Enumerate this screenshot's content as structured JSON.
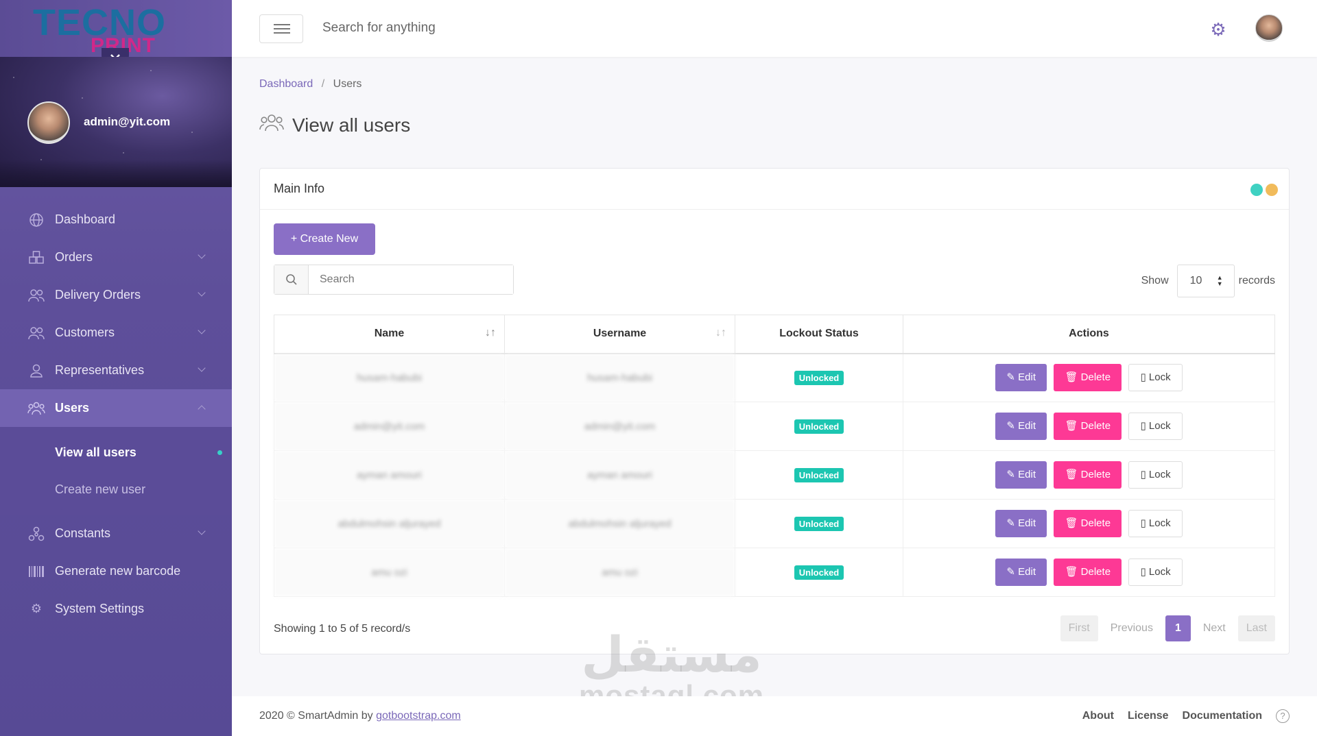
{
  "brand": {
    "logo_top": "TECNO",
    "logo_bottom": "PRINT"
  },
  "profile": {
    "email": "admin@yit.com"
  },
  "sidebar": {
    "items": [
      {
        "label": "Dashboard",
        "icon": "globe-icon"
      },
      {
        "label": "Orders",
        "icon": "boxes-icon"
      },
      {
        "label": "Delivery Orders",
        "icon": "users-icon"
      },
      {
        "label": "Customers",
        "icon": "users-icon"
      },
      {
        "label": "Representatives",
        "icon": "user-icon"
      },
      {
        "label": "Users",
        "icon": "users-icon"
      },
      {
        "label": "Constants",
        "icon": "nodes-icon"
      },
      {
        "label": "Generate new barcode",
        "icon": "barcode-icon"
      },
      {
        "label": "System Settings",
        "icon": "gear-icon"
      }
    ],
    "sub_items": [
      {
        "label": "View all users"
      },
      {
        "label": "Create new user"
      }
    ]
  },
  "header": {
    "search_placeholder": "Search for anything"
  },
  "breadcrumb": {
    "home": "Dashboard",
    "separator": "/",
    "current": "Users"
  },
  "page": {
    "title": "View all users"
  },
  "panel": {
    "title": "Main Info",
    "create_label": "+ Create New",
    "search_placeholder": "Search",
    "show_label": "Show",
    "show_value": "10",
    "records_label": "records"
  },
  "table": {
    "headers": [
      "Name",
      "Username",
      "Lockout Status",
      "Actions"
    ],
    "rows": [
      {
        "name": "husam-habubi",
        "username": "husam-habubi",
        "status": "Unlocked"
      },
      {
        "name": "admin@yit.com",
        "username": "admin@yit.com",
        "status": "Unlocked"
      },
      {
        "name": "ayman amouri",
        "username": "ayman amouri",
        "status": "Unlocked"
      },
      {
        "name": "abdulmohsin aljurayed",
        "username": "abdulmohsin aljurayed",
        "status": "Unlocked"
      },
      {
        "name": "amu ozi",
        "username": "amu ozi",
        "status": "Unlocked"
      }
    ],
    "actions": {
      "edit": "Edit",
      "delete": "Delete",
      "lock": "Lock"
    }
  },
  "pagination": {
    "showing": "Showing 1 to 5 of 5 record/s",
    "first": "First",
    "previous": "Previous",
    "current": "1",
    "next": "Next",
    "last": "Last"
  },
  "watermark": {
    "arabic": "مستقل",
    "latin": "mostaql.com"
  },
  "footer": {
    "copy_prefix": "2020 © SmartAdmin by",
    "copy_link": "gotbootstrap.com",
    "links": [
      "About",
      "License",
      "Documentation"
    ],
    "help": "?"
  },
  "colors": {
    "accent": "#8a6fc6",
    "danger": "#fd3995",
    "success": "#1cc6b1",
    "sidebar": "#5e4f9a"
  }
}
